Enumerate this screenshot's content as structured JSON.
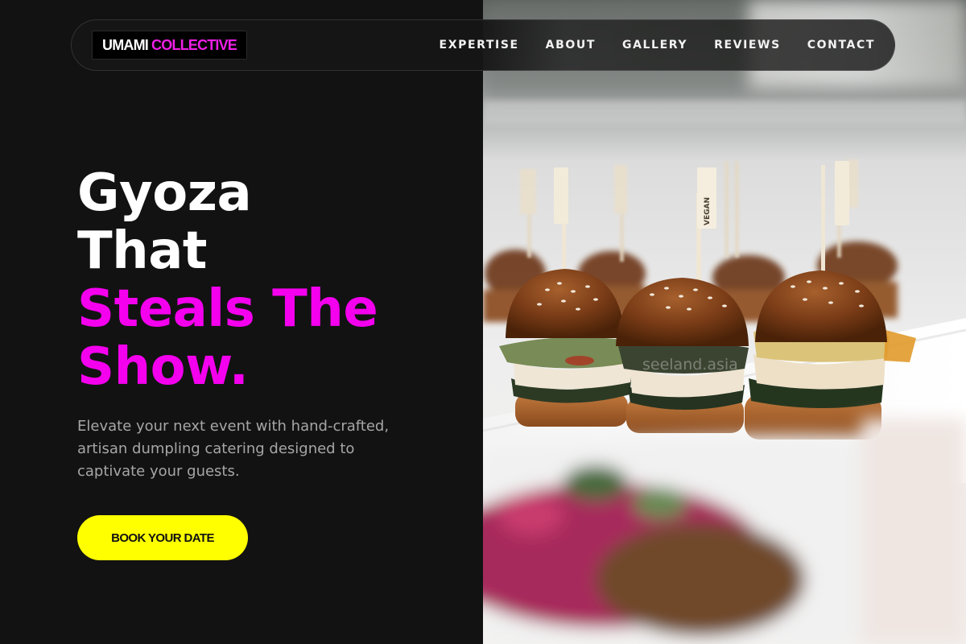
{
  "brand": {
    "name_part1": "UMAMI",
    "name_part2": "COLLECTIVE"
  },
  "nav": {
    "items": [
      "EXPERTISE",
      "ABOUT",
      "GALLERY",
      "REVIEWS",
      "CONTACT"
    ]
  },
  "hero": {
    "headline_lines": [
      "Gyoza",
      "That",
      "Steals The",
      "Show."
    ],
    "subtext": "Elevate your next event with hand-crafted, artisan dumpling catering designed to captivate your guests.",
    "cta_label": "BOOK YOUR DATE",
    "image_pick_label": "VEGAN",
    "watermark": "seeland.asia"
  },
  "colors": {
    "background": "#121212",
    "accent_pink": "#f400ee",
    "cta_yellow": "#ffff00",
    "text_white": "#ffffff",
    "text_muted": "#a6a6a6"
  }
}
